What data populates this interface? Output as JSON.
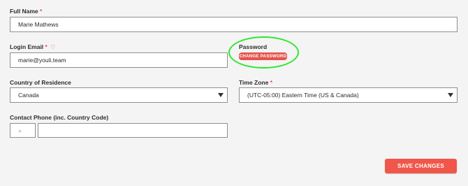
{
  "form": {
    "full_name": {
      "label": "Full Name",
      "required_mark": "*",
      "value": "Marie Mathews"
    },
    "login_email": {
      "label": "Login Email",
      "required_mark": "*",
      "extra_icon": "heart-icon",
      "value": "marie@youli.team"
    },
    "password": {
      "label": "Password",
      "button_label": "CHANGE PASSWORD"
    },
    "country": {
      "label": "Country of Residence",
      "value": "Canada"
    },
    "time_zone": {
      "label": "Time Zone",
      "required_mark": "*",
      "value": "(UTC-05:00) Eastern Time (US & Canada)"
    },
    "contact_phone": {
      "label": "Contact Phone (inc. Country Code)",
      "code_placeholder": "+",
      "number_value": ""
    },
    "save_button_label": "SAVE CHANGES"
  },
  "colors": {
    "accent": "#e5534b",
    "highlight": "#2ee62e",
    "background": "#f4f4f4"
  }
}
